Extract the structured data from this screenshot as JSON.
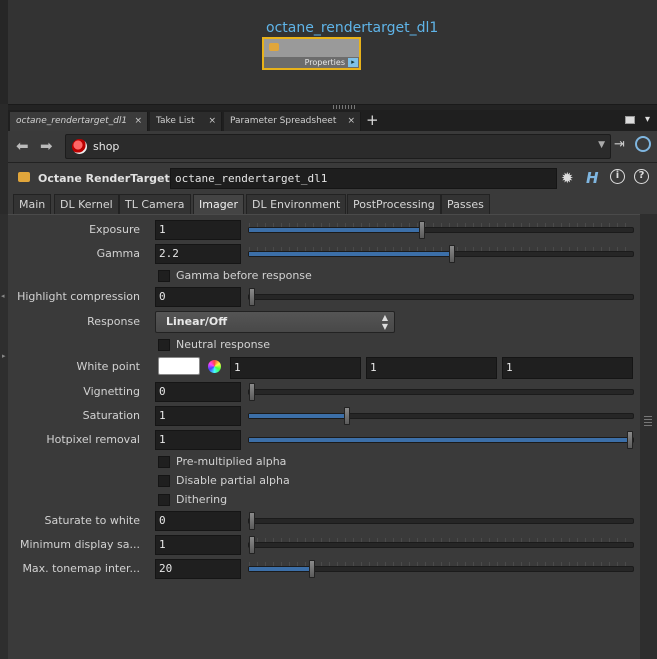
{
  "network": {
    "node_title": "octane_rendertarget_dl1",
    "node_flag_label": "Properties"
  },
  "pane_tabs": [
    {
      "label": "octane_rendertarget_dl1",
      "close": "×"
    },
    {
      "label": "Take List",
      "close": "×"
    },
    {
      "label": "Parameter Spreadsheet",
      "close": "×"
    }
  ],
  "path": {
    "text": "shop"
  },
  "operator": {
    "type_label": "Octane RenderTarget",
    "name_value": "octane_rendertarget_dl1"
  },
  "param_tabs": [
    "Main",
    "DL Kernel",
    "TL Camera",
    "Imager",
    "DL Environment",
    "PostProcessing",
    "Passes"
  ],
  "active_param_tab": "Imager",
  "params": {
    "exposure": {
      "label": "Exposure",
      "value": "1",
      "slider_frac": 0.45
    },
    "gamma": {
      "label": "Gamma",
      "value": "2.2",
      "slider_frac": 0.53
    },
    "gamma_before_response": {
      "label": "Gamma before response"
    },
    "highlight_compression": {
      "label": "Highlight compression",
      "value": "0",
      "slider_frac": 0.0
    },
    "response": {
      "label": "Response",
      "value": "Linear/Off"
    },
    "neutral_response": {
      "label": "Neutral response"
    },
    "white_point": {
      "label": "White point",
      "r": "1",
      "g": "1",
      "b": "1",
      "color": "#ffffff"
    },
    "vignetting": {
      "label": "Vignetting",
      "value": "0",
      "slider_frac": 0.0
    },
    "saturation": {
      "label": "Saturation",
      "value": "1",
      "slider_frac": 0.25
    },
    "hotpixel_removal": {
      "label": "Hotpixel removal",
      "value": "1",
      "slider_frac": 1.0
    },
    "premultiplied_alpha": {
      "label": "Pre-multiplied alpha"
    },
    "disable_partial_alpha": {
      "label": "Disable partial alpha"
    },
    "dithering": {
      "label": "Dithering"
    },
    "saturate_to_white": {
      "label": "Saturate to white",
      "value": "0",
      "slider_frac": 0.0
    },
    "min_display_samples": {
      "label": "Minimum display sa...",
      "value": "1",
      "slider_frac": 0.0
    },
    "max_tonemap_interval": {
      "label": "Max. tonemap inter...",
      "value": "20",
      "slider_frac": 0.16
    }
  },
  "colors": {
    "accent_blue": "#3c6fa8",
    "node_title": "#5fb4e8",
    "node_select": "#e8b21a"
  }
}
